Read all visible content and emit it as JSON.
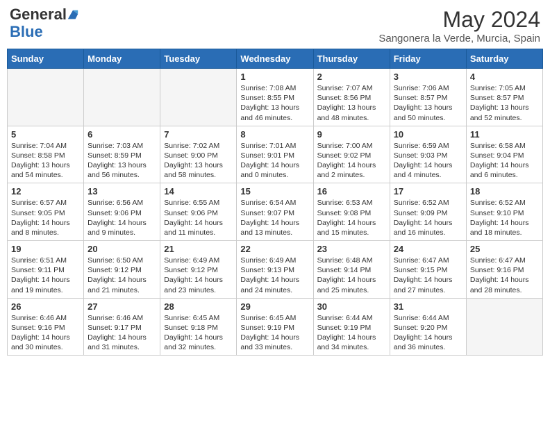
{
  "header": {
    "logo_general": "General",
    "logo_blue": "Blue",
    "title": "May 2024",
    "location": "Sangonera la Verde, Murcia, Spain"
  },
  "days_of_week": [
    "Sunday",
    "Monday",
    "Tuesday",
    "Wednesday",
    "Thursday",
    "Friday",
    "Saturday"
  ],
  "weeks": [
    [
      {
        "day": "",
        "content": ""
      },
      {
        "day": "",
        "content": ""
      },
      {
        "day": "",
        "content": ""
      },
      {
        "day": "1",
        "content": "Sunrise: 7:08 AM\nSunset: 8:55 PM\nDaylight: 13 hours and 46 minutes."
      },
      {
        "day": "2",
        "content": "Sunrise: 7:07 AM\nSunset: 8:56 PM\nDaylight: 13 hours and 48 minutes."
      },
      {
        "day": "3",
        "content": "Sunrise: 7:06 AM\nSunset: 8:57 PM\nDaylight: 13 hours and 50 minutes."
      },
      {
        "day": "4",
        "content": "Sunrise: 7:05 AM\nSunset: 8:57 PM\nDaylight: 13 hours and 52 minutes."
      }
    ],
    [
      {
        "day": "5",
        "content": "Sunrise: 7:04 AM\nSunset: 8:58 PM\nDaylight: 13 hours and 54 minutes."
      },
      {
        "day": "6",
        "content": "Sunrise: 7:03 AM\nSunset: 8:59 PM\nDaylight: 13 hours and 56 minutes."
      },
      {
        "day": "7",
        "content": "Sunrise: 7:02 AM\nSunset: 9:00 PM\nDaylight: 13 hours and 58 minutes."
      },
      {
        "day": "8",
        "content": "Sunrise: 7:01 AM\nSunset: 9:01 PM\nDaylight: 14 hours and 0 minutes."
      },
      {
        "day": "9",
        "content": "Sunrise: 7:00 AM\nSunset: 9:02 PM\nDaylight: 14 hours and 2 minutes."
      },
      {
        "day": "10",
        "content": "Sunrise: 6:59 AM\nSunset: 9:03 PM\nDaylight: 14 hours and 4 minutes."
      },
      {
        "day": "11",
        "content": "Sunrise: 6:58 AM\nSunset: 9:04 PM\nDaylight: 14 hours and 6 minutes."
      }
    ],
    [
      {
        "day": "12",
        "content": "Sunrise: 6:57 AM\nSunset: 9:05 PM\nDaylight: 14 hours and 8 minutes."
      },
      {
        "day": "13",
        "content": "Sunrise: 6:56 AM\nSunset: 9:06 PM\nDaylight: 14 hours and 9 minutes."
      },
      {
        "day": "14",
        "content": "Sunrise: 6:55 AM\nSunset: 9:06 PM\nDaylight: 14 hours and 11 minutes."
      },
      {
        "day": "15",
        "content": "Sunrise: 6:54 AM\nSunset: 9:07 PM\nDaylight: 14 hours and 13 minutes."
      },
      {
        "day": "16",
        "content": "Sunrise: 6:53 AM\nSunset: 9:08 PM\nDaylight: 14 hours and 15 minutes."
      },
      {
        "day": "17",
        "content": "Sunrise: 6:52 AM\nSunset: 9:09 PM\nDaylight: 14 hours and 16 minutes."
      },
      {
        "day": "18",
        "content": "Sunrise: 6:52 AM\nSunset: 9:10 PM\nDaylight: 14 hours and 18 minutes."
      }
    ],
    [
      {
        "day": "19",
        "content": "Sunrise: 6:51 AM\nSunset: 9:11 PM\nDaylight: 14 hours and 19 minutes."
      },
      {
        "day": "20",
        "content": "Sunrise: 6:50 AM\nSunset: 9:12 PM\nDaylight: 14 hours and 21 minutes."
      },
      {
        "day": "21",
        "content": "Sunrise: 6:49 AM\nSunset: 9:12 PM\nDaylight: 14 hours and 23 minutes."
      },
      {
        "day": "22",
        "content": "Sunrise: 6:49 AM\nSunset: 9:13 PM\nDaylight: 14 hours and 24 minutes."
      },
      {
        "day": "23",
        "content": "Sunrise: 6:48 AM\nSunset: 9:14 PM\nDaylight: 14 hours and 25 minutes."
      },
      {
        "day": "24",
        "content": "Sunrise: 6:47 AM\nSunset: 9:15 PM\nDaylight: 14 hours and 27 minutes."
      },
      {
        "day": "25",
        "content": "Sunrise: 6:47 AM\nSunset: 9:16 PM\nDaylight: 14 hours and 28 minutes."
      }
    ],
    [
      {
        "day": "26",
        "content": "Sunrise: 6:46 AM\nSunset: 9:16 PM\nDaylight: 14 hours and 30 minutes."
      },
      {
        "day": "27",
        "content": "Sunrise: 6:46 AM\nSunset: 9:17 PM\nDaylight: 14 hours and 31 minutes."
      },
      {
        "day": "28",
        "content": "Sunrise: 6:45 AM\nSunset: 9:18 PM\nDaylight: 14 hours and 32 minutes."
      },
      {
        "day": "29",
        "content": "Sunrise: 6:45 AM\nSunset: 9:19 PM\nDaylight: 14 hours and 33 minutes."
      },
      {
        "day": "30",
        "content": "Sunrise: 6:44 AM\nSunset: 9:19 PM\nDaylight: 14 hours and 34 minutes."
      },
      {
        "day": "31",
        "content": "Sunrise: 6:44 AM\nSunset: 9:20 PM\nDaylight: 14 hours and 36 minutes."
      },
      {
        "day": "",
        "content": ""
      }
    ]
  ]
}
